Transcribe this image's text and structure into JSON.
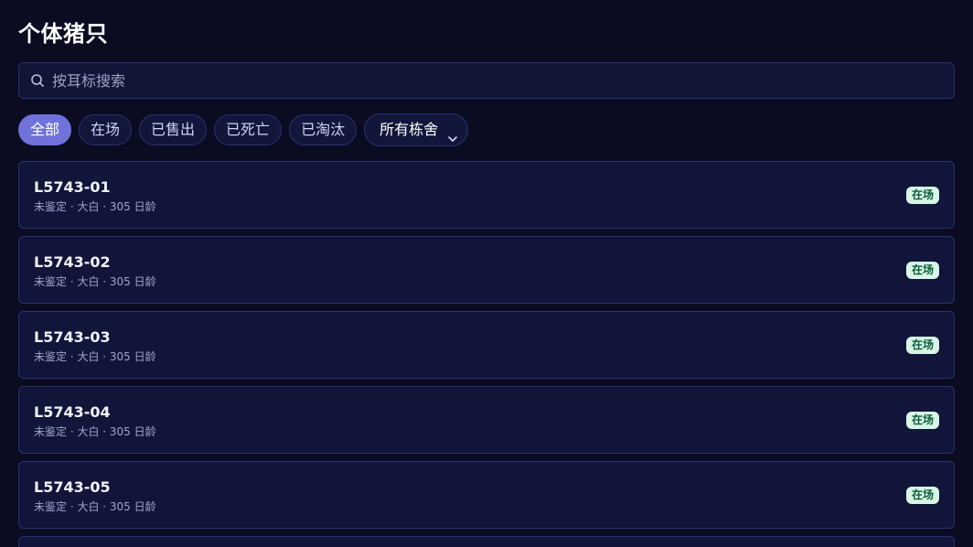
{
  "page": {
    "title": "个体猪只"
  },
  "search": {
    "placeholder": "按耳标搜索",
    "value": ""
  },
  "filters": {
    "chips": [
      {
        "label": "全部",
        "active": true
      },
      {
        "label": "在场",
        "active": false
      },
      {
        "label": "已售出",
        "active": false
      },
      {
        "label": "已死亡",
        "active": false
      },
      {
        "label": "已淘汰",
        "active": false
      }
    ],
    "barn_select": {
      "selected": "所有栋舍"
    }
  },
  "pigs": [
    {
      "id": "L5743-01",
      "meta": "未鉴定 · 大白 · 305 日龄",
      "status": "在场"
    },
    {
      "id": "L5743-02",
      "meta": "未鉴定 · 大白 · 305 日龄",
      "status": "在场"
    },
    {
      "id": "L5743-03",
      "meta": "未鉴定 · 大白 · 305 日龄",
      "status": "在场"
    },
    {
      "id": "L5743-04",
      "meta": "未鉴定 · 大白 · 305 日龄",
      "status": "在场"
    },
    {
      "id": "L5743-05",
      "meta": "未鉴定 · 大白 · 305 日龄",
      "status": "在场"
    }
  ],
  "colors": {
    "background": "#0b0b22",
    "card": "#11153a",
    "accent": "#6f72d9",
    "status_in_farm_bg": "#d7f6e6",
    "status_in_farm_text": "#0d5a3b"
  },
  "icons": {
    "search": "search-icon",
    "dropdown": "chevron-down-icon"
  }
}
